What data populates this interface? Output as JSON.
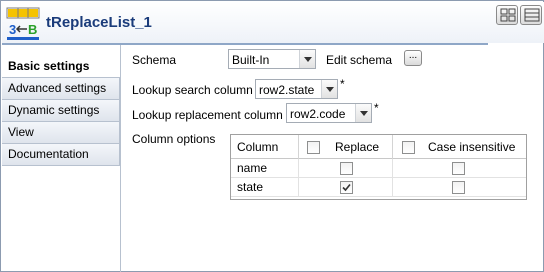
{
  "component": {
    "title": "tReplaceList_1",
    "icon": "treplacelist-component-icon"
  },
  "header_buttons": [
    "view-toggle-icon",
    "layout-icon"
  ],
  "sidebar": {
    "items": [
      {
        "label": "Basic settings",
        "active": true
      },
      {
        "label": "Advanced settings",
        "active": false
      },
      {
        "label": "Dynamic settings",
        "active": false
      },
      {
        "label": "View",
        "active": false
      },
      {
        "label": "Documentation",
        "active": false
      }
    ]
  },
  "form": {
    "schema_label": "Schema",
    "schema_value": "Built-In",
    "edit_schema_label": "Edit schema",
    "edit_schema_button": "...",
    "lookup_search_label": "Lookup search column",
    "lookup_search_value": "row2.state",
    "lookup_replacement_label": "Lookup replacement column",
    "lookup_replacement_value": "row2.code",
    "required_marker": "*",
    "column_options_label": "Column options"
  },
  "table": {
    "headers": {
      "column": "Column",
      "replace": "Replace",
      "case_insensitive": "Case insensitive"
    },
    "rows": [
      {
        "column": "name",
        "replace": false,
        "case_insensitive": false
      },
      {
        "column": "state",
        "replace": true,
        "case_insensitive": false
      }
    ]
  }
}
